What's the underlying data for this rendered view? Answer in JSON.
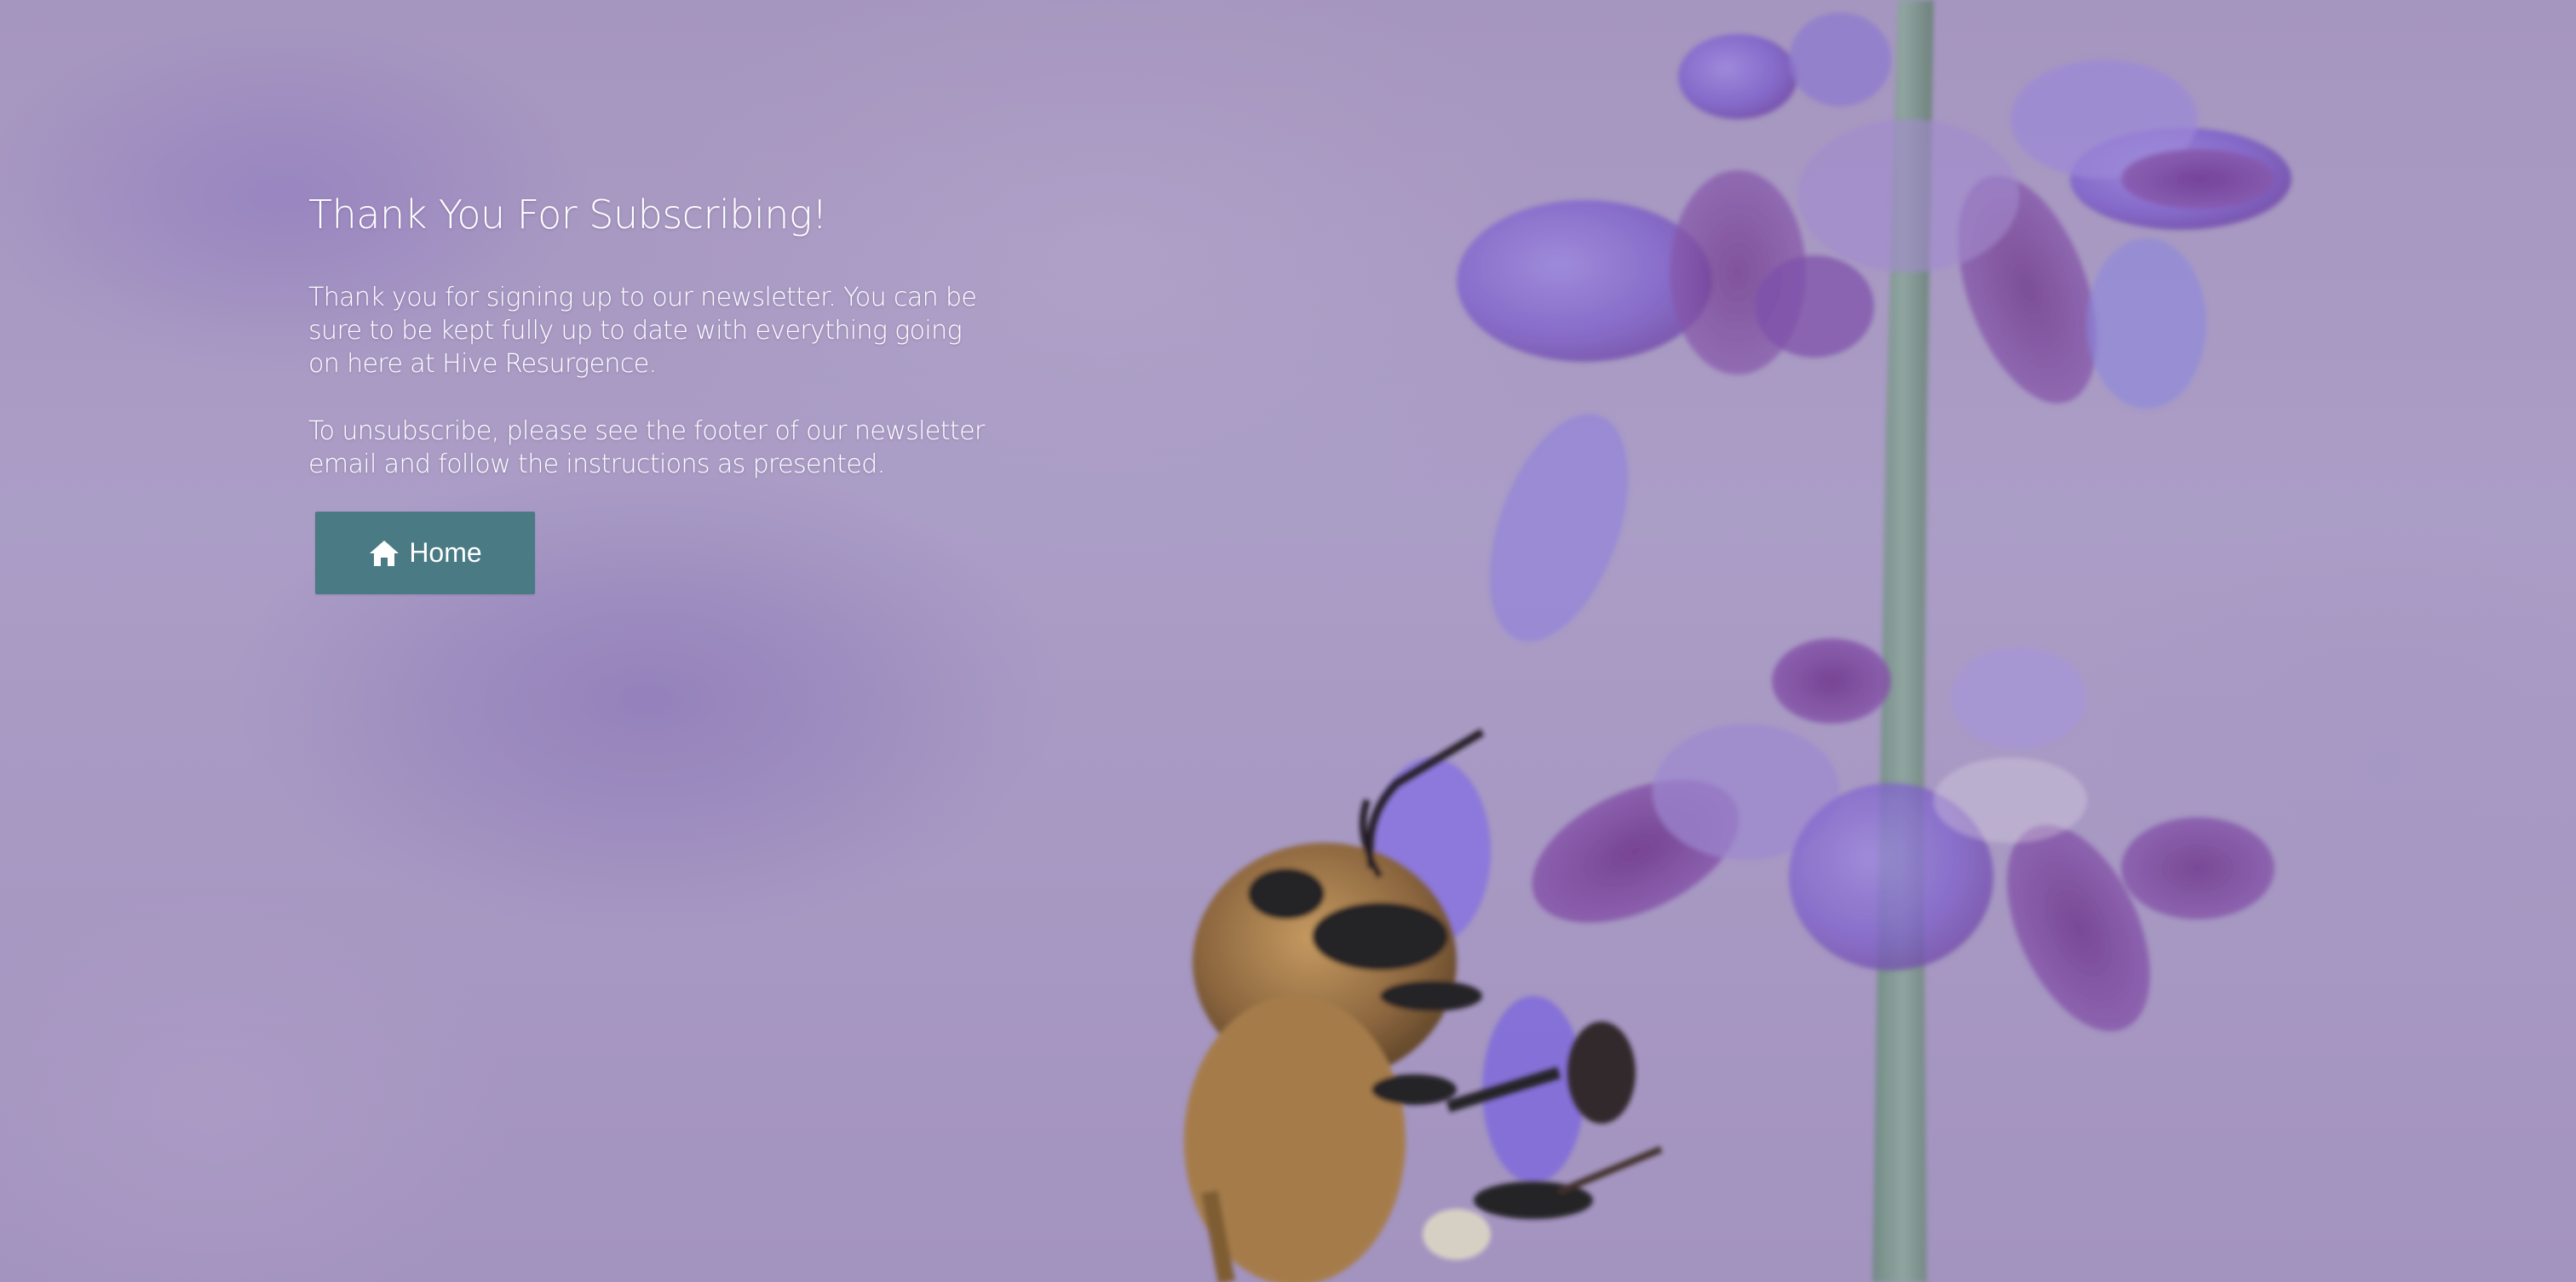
{
  "page": {
    "title": "Thank You For Subscribing!",
    "paragraphs": [
      "Thank you for signing up to our newsletter. You can be sure to be kept fully up to date with everything going on here at Hive Resurgence.",
      "To unsubscribe, please see the footer of our newsletter email and follow the instructions as presented."
    ]
  },
  "home_button": {
    "label": "Home",
    "icon": "home-icon",
    "color": "#4a7b85"
  },
  "background": {
    "description_icon": "bee-on-lavender-photo",
    "accent": "#a99bc2"
  }
}
